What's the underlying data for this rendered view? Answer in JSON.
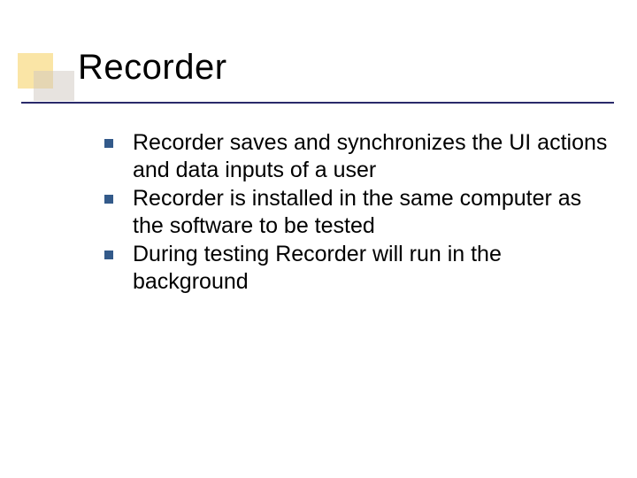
{
  "slide": {
    "title": "Recorder",
    "bullets": [
      "Recorder saves and synchronizes the UI actions and data inputs of a user",
      "Recorder is installed in the same computer as the software to be tested",
      "During testing Recorder will run in the background"
    ]
  }
}
